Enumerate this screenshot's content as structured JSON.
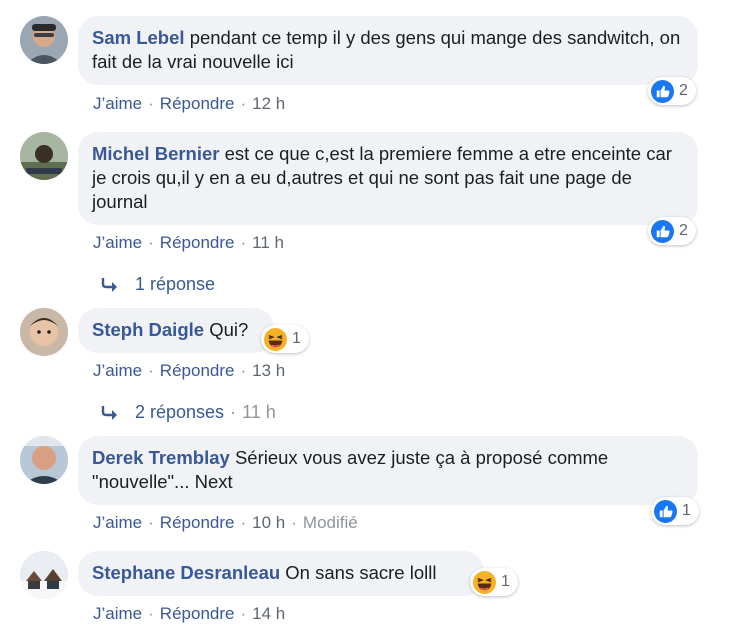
{
  "comments": [
    {
      "author": "Sam Lebel",
      "text": "pendant ce temp il y des gens qui mange des sandwitch, on fait de la vrai nouvelle ici",
      "like_label": "J’aime",
      "reply_label": "Répondre",
      "time": "12 h",
      "reaction": {
        "icon": "like-icon",
        "count": "2"
      }
    },
    {
      "author": "Michel Bernier",
      "text": "est ce que c,est la premiere femme a etre enceinte car je crois qu,il y en a eu d,autres et qui ne sont pas fait une page de journal",
      "like_label": "J’aime",
      "reply_label": "Répondre",
      "time": "11 h",
      "reaction": {
        "icon": "like-icon",
        "count": "2"
      },
      "replies": {
        "label": "1 réponse"
      }
    },
    {
      "author": "Steph Daigle",
      "text": "Qui?",
      "like_label": "J’aime",
      "reply_label": "Répondre",
      "time": "13 h",
      "reaction": {
        "icon": "haha-icon",
        "count": "1"
      },
      "replies": {
        "label": "2 réponses",
        "time": "11 h"
      }
    },
    {
      "author": "Derek Tremblay",
      "text": "Sérieux vous avez juste ça à proposé comme \"nouvelle\"... Next",
      "like_label": "J’aime",
      "reply_label": "Répondre",
      "time": "10 h",
      "edited": "Modifié",
      "reaction": {
        "icon": "like-icon",
        "count": "1"
      }
    },
    {
      "author": "Stephane Desranleau",
      "text": "On sans sacre lolll",
      "like_label": "J’aime",
      "reply_label": "Répondre",
      "time": "14 h",
      "reaction": {
        "icon": "haha-icon",
        "count": "1"
      }
    }
  ],
  "separator": "·",
  "colors": {
    "link": "#385898",
    "bubble": "#f0f2f5",
    "like_blue": "#1877f2",
    "haha_yellow": "#f7b125"
  }
}
